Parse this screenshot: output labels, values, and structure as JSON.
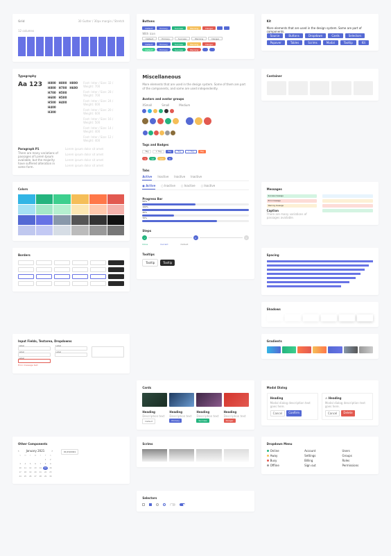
{
  "grid": {
    "title": "Grid",
    "meta_left": "12 columns",
    "meta_right": "30 Gutter / 30px margin / Stretch"
  },
  "buttons": {
    "title": "Buttons",
    "row1": [
      {
        "l": "Default",
        "c": "#5469d4"
      },
      {
        "l": "Primary",
        "c": "#5469d4"
      },
      {
        "l": "Success",
        "c": "#24b47e"
      },
      {
        "l": "Warning",
        "c": "#f5be58"
      },
      {
        "l": "Danger",
        "c": "#e25950"
      },
      {
        "l": "",
        "c": "#5469d4"
      },
      {
        "l": "",
        "c": "#5469d4"
      }
    ],
    "label2": "With icon",
    "row2": [
      {
        "l": "Default"
      },
      {
        "l": "Primary"
      },
      {
        "l": "Success"
      },
      {
        "l": "Warning"
      },
      {
        "l": "Danger"
      }
    ],
    "row3": [
      {
        "l": "Default",
        "c": "#5469d4"
      },
      {
        "l": "Primary",
        "c": "#5469d4"
      },
      {
        "l": "Success",
        "c": "#24b47e"
      },
      {
        "l": "Warning",
        "c": "#f5be58"
      },
      {
        "l": "Danger",
        "c": "#e25950"
      }
    ],
    "row4": [
      {
        "l": "Default",
        "c": "#3ecf8e"
      },
      {
        "l": "Primary",
        "c": "#5469d4"
      },
      {
        "l": "Success",
        "c": "#24b47e"
      },
      {
        "l": "Warning",
        "c": "#e25950"
      },
      {
        "l": "",
        "c": "#5469d4"
      },
      {
        "l": "",
        "c": "#5469d4"
      }
    ]
  },
  "kit": {
    "title": "Kit",
    "desc": "More elements that are used in the design system. Some are part of components.",
    "items": [
      "Source",
      "Buttons",
      "Dropdown",
      "Cards",
      "Selectors",
      "Popover",
      "Tables",
      "Scrims",
      "Modal",
      "Tooltip",
      "Kit"
    ]
  },
  "typography": {
    "title": "Typography",
    "sample": "Aa 123",
    "weights": [
      [
        "H800",
        "H800",
        "H800"
      ],
      [
        "H800",
        "H700",
        "H600"
      ],
      [
        "H700",
        "H500"
      ],
      [
        "H600",
        "H500"
      ],
      [
        "H500",
        "H400"
      ],
      [
        "H400"
      ],
      [
        "H300"
      ]
    ],
    "specs": [
      "Font: Inter / Size: 32 / Weight: 700",
      "Font: Inter / Size: 28 / Weight: 700",
      "Font: Inter / Size: 24 / Weight: 600",
      "Font: Inter / Size: 20 / Weight: 600",
      "Font: Inter / Size: 16 / Weight: 500",
      "Font: Inter / Size: 14 / Weight: 400",
      "Font: Inter / Size: 12 / Weight: 400"
    ],
    "para_label": "Paragraph P1",
    "para": "There are many variations of passages of Lorem Ipsum available, but the majority have suffered alteration in some form.",
    "lines": [
      "Lorem ipsum dolor sit amet",
      "Lorem ipsum dolor sit amet",
      "Lorem ipsum dolor sit amet",
      "Lorem ipsum dolor sit amet"
    ]
  },
  "misc": {
    "title": "Miscellaneous",
    "desc": "More elements that are used in the design system. Some of them are part of the components, and some are used independently.",
    "avatars": {
      "title": "Avatars and avatar groups",
      "labels": [
        "XSmall",
        "Small",
        "Medium"
      ],
      "xs": [
        "#5469d4",
        "#32b5e5",
        "#f5be58",
        "#24b47e",
        "#333",
        "#e25950"
      ],
      "s": [
        "#8a6d3b",
        "#5469d4",
        "#e25950",
        "#24b47e",
        "#f5be58"
      ],
      "m": [
        "#5469d4",
        "#f5be58",
        "#e25950"
      ],
      "grp": [
        "#5469d4",
        "#24b47e",
        "#e25950",
        "#f5be58",
        "#999",
        "#8a6d3b"
      ]
    },
    "tags": {
      "title": "Tags and Badges",
      "r1": [
        {
          "t": "Tag",
          "bg": "#fff",
          "bd": "#ddd",
          "c": "#666"
        },
        {
          "t": "× Tag",
          "bg": "#fff",
          "bd": "#ddd",
          "c": "#666"
        },
        {
          "t": "Tag",
          "bg": "#5469d4",
          "c": "#fff"
        },
        {
          "t": "Tag",
          "bg": "#fff",
          "bd": "#5469d4",
          "c": "#5469d4"
        },
        {
          "t": "× Tag",
          "bg": "#fff",
          "bd": "#5469d4",
          "c": "#5469d4"
        },
        {
          "t": "Tag",
          "bg": "#ff7849",
          "c": "#fff"
        }
      ],
      "r2": [
        {
          "t": "1",
          "bg": "#e25950",
          "r": 1
        },
        {
          "t": "12",
          "bg": "#24b47e",
          "r": 1
        },
        {
          "t": "123",
          "bg": "#f5be58",
          "r": 1
        },
        {
          "t": "8",
          "bg": "#5469d4",
          "r": 1
        }
      ]
    },
    "tabs": {
      "title": "Tabs",
      "items": [
        "Active",
        "Inactive",
        "Inactive",
        "Inactive"
      ],
      "icons": [
        "● Active",
        "○ Inactive",
        "○ Inactive",
        "○ Inactive"
      ]
    },
    "progress": {
      "title": "Progress Bar",
      "bars": [
        {
          "p": 50,
          "l": "50%"
        },
        {
          "p": 100,
          "l": "100%"
        },
        {
          "p": 30,
          "l": "30%"
        },
        {
          "p": 70,
          "l": "70%"
        }
      ]
    },
    "steps": {
      "title": "Steps",
      "items": [
        {
          "c": "#24b47e",
          "l": "Done",
          "i": "✓"
        },
        {
          "c": "#5469d4",
          "l": "Current",
          "i": "2"
        },
        {
          "c": "#ddd",
          "l": "Default",
          "i": "3"
        }
      ]
    },
    "tooltips": {
      "title": "Tooltips",
      "items": [
        {
          "t": "Tooltip",
          "bg": "#fff",
          "bd": "#ddd",
          "c": "#333"
        },
        {
          "t": "Tooltip",
          "bg": "#2a2a2a",
          "c": "#fff"
        }
      ]
    }
  },
  "containers": {
    "title": "Container",
    "count": 5
  },
  "messages": {
    "title": "Messages",
    "left": [
      {
        "t": "Success message",
        "c": "#d4f4e2"
      },
      {
        "t": "Error message",
        "c": "#fddcd7"
      },
      {
        "t": "Warning message",
        "c": "#fdf0d5"
      }
    ],
    "leftlabel": "Caption",
    "leftdesc": "There are many variations of passages available.",
    "right": [
      {
        "t": "",
        "c": "#e8f4fd"
      },
      {
        "t": "",
        "c": "#fdf0d5"
      },
      {
        "t": "",
        "c": "#fddcd7"
      },
      {
        "t": "",
        "c": "#d4f4e2"
      }
    ]
  },
  "colors": {
    "title": "Colors",
    "rows": [
      [
        "#32b5e5",
        "#24b47e",
        "#3ecf8e",
        "#f5be58",
        "#ff7849",
        "#e25950"
      ],
      [
        "#a6e1f4",
        "#a4e8c9",
        "#b5f0d0",
        "#fce7b3",
        "#ffc9ad",
        "#f4b2ac"
      ],
      [
        "#5469d4",
        "#6772e5",
        "#8898aa",
        "#555",
        "#333",
        "#111"
      ],
      [
        "#c0c8ef",
        "#c3c9f4",
        "#d6dde5",
        "#bbb",
        "#999",
        "#777"
      ]
    ]
  },
  "spacing": {
    "title": "Spacing",
    "bars": [
      100,
      96,
      92,
      88,
      84,
      78,
      70
    ]
  },
  "borders": {
    "title": "Borders"
  },
  "shadows": {
    "title": "Shadows",
    "items": [
      0.03,
      0.06,
      0.09,
      0.12,
      0.16,
      0.2
    ]
  },
  "gradients": {
    "title": "Gradients",
    "items": [
      [
        "#32b5e5",
        "#5469d4"
      ],
      [
        "#24b47e",
        "#3ecf8e"
      ],
      [
        "#ff7849",
        "#e25950"
      ],
      [
        "#f5be58",
        "#ff7849"
      ],
      [
        "#5469d4",
        "#6772e5"
      ],
      [
        "#8898aa",
        "#555"
      ],
      [
        "#999",
        "#ccc"
      ]
    ]
  },
  "inputs": {
    "title": "Input Fields, Textarea, Dropdowns",
    "col1": [
      {
        "l": "Label"
      },
      {
        "l": "Label"
      },
      {
        "l": "Label",
        "err": true,
        "msg": "Error message text"
      }
    ],
    "col2": [
      {
        "l": "Label"
      },
      {
        "l": "Label"
      }
    ]
  },
  "cards": {
    "title": "Cards",
    "imgs": [
      [
        "#2d4a3e",
        "#1a2e24"
      ],
      [
        "#1e3a5f",
        "#6b9bd1"
      ],
      [
        "#3d2645",
        "#8b5a8c"
      ],
      [
        "#d4342c",
        "#e25950"
      ]
    ],
    "meta": [
      {
        "t": "Heading",
        "d": "Description text",
        "b": "Default",
        "bc": "#fff",
        "bd": "#ddd"
      },
      {
        "t": "Heading",
        "d": "Description text",
        "b": "Primary",
        "bc": "#5469d4"
      },
      {
        "t": "Heading",
        "d": "Description text",
        "b": "Success",
        "bc": "#24b47e"
      },
      {
        "t": "Heading",
        "d": "Description text",
        "b": "Danger",
        "bc": "#e25950"
      }
    ]
  },
  "modal": {
    "title": "Modal Dialog",
    "mods": [
      {
        "t": "Heading",
        "d": "Modal dialog description text goes here.",
        "b": [
          {
            "t": "Cancel",
            "c": "#fff",
            "bd": "#ddd"
          },
          {
            "t": "Confirm",
            "c": "#5469d4",
            "tc": "#fff"
          }
        ]
      },
      {
        "t": "⚠ Heading",
        "d": "Modal dialog description text goes here.",
        "b": [
          {
            "t": "Cancel",
            "c": "#fff",
            "bd": "#ddd"
          },
          {
            "t": "Delete",
            "c": "#e25950",
            "tc": "#fff"
          }
        ]
      }
    ]
  },
  "other": {
    "title": "Other Components",
    "month": "January",
    "year": "2021",
    "date_input": "01/15/2021",
    "days": [
      "S",
      "M",
      "T",
      "W",
      "T",
      "F",
      "S"
    ]
  },
  "scrims": {
    "title": "Scrims"
  },
  "dropdown": {
    "title": "Dropdown Menu",
    "col1": [
      {
        "c": "#24b47e",
        "t": "Online"
      },
      {
        "c": "#f5be58",
        "t": "Away"
      },
      {
        "c": "#e25950",
        "t": "Busy"
      },
      {
        "c": "#999",
        "t": "Offline"
      }
    ],
    "col2": [
      {
        "t": "Account"
      },
      {
        "t": "Settings"
      },
      {
        "t": "Billing"
      },
      {
        "t": "Sign out"
      }
    ],
    "col3": [
      {
        "t": "Users"
      },
      {
        "t": "Groups"
      },
      {
        "t": "Roles"
      },
      {
        "t": "Permissions"
      }
    ]
  },
  "selectors": {
    "title": "Selectors"
  }
}
